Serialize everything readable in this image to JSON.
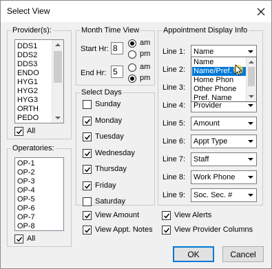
{
  "window": {
    "title": "Select View"
  },
  "providers": {
    "label": "Provider(s):",
    "items": [
      "DDS1",
      "DDS2",
      "DDS3",
      "ENDO",
      "HYG1",
      "HYG2",
      "HYG3",
      "ORTH",
      "PEDO"
    ],
    "all_label": "All",
    "all_checked": true
  },
  "operatories": {
    "label": "Operatories:",
    "items": [
      "OP-1",
      "OP-2",
      "OP-3",
      "OP-4",
      "OP-5",
      "OP-6",
      "OP-7",
      "OP-8"
    ],
    "all_label": "All",
    "all_checked": true
  },
  "month_time": {
    "label": "Month Time View",
    "start_label": "Start Hr:",
    "start_value": "8",
    "start_ampm": "am",
    "end_label": "End Hr:",
    "end_value": "5",
    "end_ampm": "pm",
    "am_label": "am",
    "pm_label": "pm"
  },
  "select_days": {
    "label": "Select Days",
    "days": [
      {
        "label": "Sunday",
        "checked": false
      },
      {
        "label": "Monday",
        "checked": true
      },
      {
        "label": "Tuesday",
        "checked": true
      },
      {
        "label": "Wednesday",
        "checked": true
      },
      {
        "label": "Thursday",
        "checked": true
      },
      {
        "label": "Friday",
        "checked": true
      },
      {
        "label": "Saturday",
        "checked": false
      }
    ]
  },
  "display_info": {
    "label": "Appointment Display Info",
    "lines": [
      {
        "label": "Line 1:",
        "value": "Name"
      },
      {
        "label": "Line 2:",
        "value": ""
      },
      {
        "label": "Line 3:",
        "value": ""
      },
      {
        "label": "Line 4:",
        "value": "Provider"
      },
      {
        "label": "Line 5:",
        "value": "Amount"
      },
      {
        "label": "Line 6:",
        "value": "Appt Type"
      },
      {
        "label": "Line 7:",
        "value": "Staff"
      },
      {
        "label": "Line 8:",
        "value": "Work Phone"
      },
      {
        "label": "Line 9:",
        "value": "Soc. Sec. #"
      }
    ],
    "dropdown_options": [
      "Name",
      "Name/Pref.",
      "Home Phon",
      "Other Phone",
      "Pref. Name"
    ],
    "dropdown_highlighted": "Name/Pref."
  },
  "options": {
    "view_amount": {
      "label": "View Amount",
      "checked": true
    },
    "view_appt_notes": {
      "label": "View Appt. Notes",
      "checked": true
    },
    "view_alerts": {
      "label": "View Alerts",
      "checked": true
    },
    "view_provider_columns": {
      "label": "View Provider Columns",
      "checked": true
    }
  },
  "buttons": {
    "ok": "OK",
    "cancel": "Cancel"
  }
}
